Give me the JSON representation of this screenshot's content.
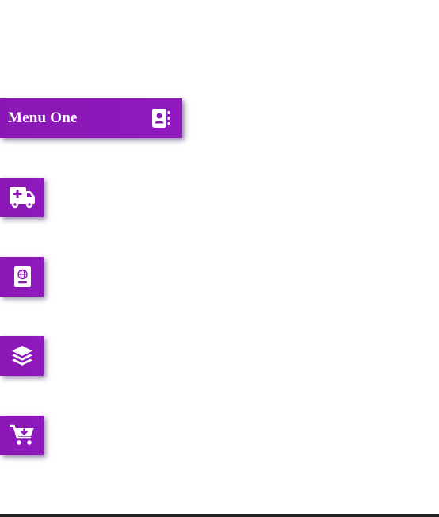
{
  "menu": {
    "items": [
      {
        "label": "Menu One",
        "icon": "address-book-icon",
        "expanded": true
      },
      {
        "label": "",
        "icon": "ambulance-icon",
        "expanded": false
      },
      {
        "label": "",
        "icon": "passport-book-icon",
        "expanded": false
      },
      {
        "label": "",
        "icon": "layers-icon",
        "expanded": false
      },
      {
        "label": "",
        "icon": "cart-download-icon",
        "expanded": false
      }
    ]
  },
  "colors": {
    "accent": "#8a17b5",
    "icon": "#ffffff",
    "background": "#ffffff",
    "bottom_bar": "#222222"
  }
}
